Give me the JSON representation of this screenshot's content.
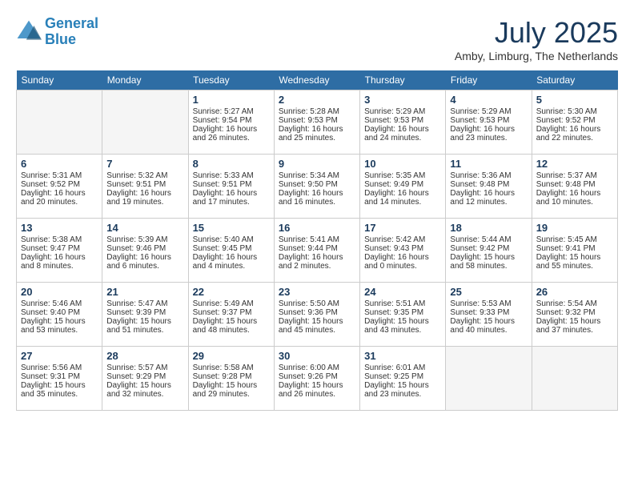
{
  "header": {
    "logo_line1": "General",
    "logo_line2": "Blue",
    "month": "July 2025",
    "location": "Amby, Limburg, The Netherlands"
  },
  "weekdays": [
    "Sunday",
    "Monday",
    "Tuesday",
    "Wednesday",
    "Thursday",
    "Friday",
    "Saturday"
  ],
  "weeks": [
    [
      {
        "day": "",
        "info": ""
      },
      {
        "day": "",
        "info": ""
      },
      {
        "day": "1",
        "info": "Sunrise: 5:27 AM\nSunset: 9:54 PM\nDaylight: 16 hours\nand 26 minutes."
      },
      {
        "day": "2",
        "info": "Sunrise: 5:28 AM\nSunset: 9:53 PM\nDaylight: 16 hours\nand 25 minutes."
      },
      {
        "day": "3",
        "info": "Sunrise: 5:29 AM\nSunset: 9:53 PM\nDaylight: 16 hours\nand 24 minutes."
      },
      {
        "day": "4",
        "info": "Sunrise: 5:29 AM\nSunset: 9:53 PM\nDaylight: 16 hours\nand 23 minutes."
      },
      {
        "day": "5",
        "info": "Sunrise: 5:30 AM\nSunset: 9:52 PM\nDaylight: 16 hours\nand 22 minutes."
      }
    ],
    [
      {
        "day": "6",
        "info": "Sunrise: 5:31 AM\nSunset: 9:52 PM\nDaylight: 16 hours\nand 20 minutes."
      },
      {
        "day": "7",
        "info": "Sunrise: 5:32 AM\nSunset: 9:51 PM\nDaylight: 16 hours\nand 19 minutes."
      },
      {
        "day": "8",
        "info": "Sunrise: 5:33 AM\nSunset: 9:51 PM\nDaylight: 16 hours\nand 17 minutes."
      },
      {
        "day": "9",
        "info": "Sunrise: 5:34 AM\nSunset: 9:50 PM\nDaylight: 16 hours\nand 16 minutes."
      },
      {
        "day": "10",
        "info": "Sunrise: 5:35 AM\nSunset: 9:49 PM\nDaylight: 16 hours\nand 14 minutes."
      },
      {
        "day": "11",
        "info": "Sunrise: 5:36 AM\nSunset: 9:48 PM\nDaylight: 16 hours\nand 12 minutes."
      },
      {
        "day": "12",
        "info": "Sunrise: 5:37 AM\nSunset: 9:48 PM\nDaylight: 16 hours\nand 10 minutes."
      }
    ],
    [
      {
        "day": "13",
        "info": "Sunrise: 5:38 AM\nSunset: 9:47 PM\nDaylight: 16 hours\nand 8 minutes."
      },
      {
        "day": "14",
        "info": "Sunrise: 5:39 AM\nSunset: 9:46 PM\nDaylight: 16 hours\nand 6 minutes."
      },
      {
        "day": "15",
        "info": "Sunrise: 5:40 AM\nSunset: 9:45 PM\nDaylight: 16 hours\nand 4 minutes."
      },
      {
        "day": "16",
        "info": "Sunrise: 5:41 AM\nSunset: 9:44 PM\nDaylight: 16 hours\nand 2 minutes."
      },
      {
        "day": "17",
        "info": "Sunrise: 5:42 AM\nSunset: 9:43 PM\nDaylight: 16 hours\nand 0 minutes."
      },
      {
        "day": "18",
        "info": "Sunrise: 5:44 AM\nSunset: 9:42 PM\nDaylight: 15 hours\nand 58 minutes."
      },
      {
        "day": "19",
        "info": "Sunrise: 5:45 AM\nSunset: 9:41 PM\nDaylight: 15 hours\nand 55 minutes."
      }
    ],
    [
      {
        "day": "20",
        "info": "Sunrise: 5:46 AM\nSunset: 9:40 PM\nDaylight: 15 hours\nand 53 minutes."
      },
      {
        "day": "21",
        "info": "Sunrise: 5:47 AM\nSunset: 9:39 PM\nDaylight: 15 hours\nand 51 minutes."
      },
      {
        "day": "22",
        "info": "Sunrise: 5:49 AM\nSunset: 9:37 PM\nDaylight: 15 hours\nand 48 minutes."
      },
      {
        "day": "23",
        "info": "Sunrise: 5:50 AM\nSunset: 9:36 PM\nDaylight: 15 hours\nand 45 minutes."
      },
      {
        "day": "24",
        "info": "Sunrise: 5:51 AM\nSunset: 9:35 PM\nDaylight: 15 hours\nand 43 minutes."
      },
      {
        "day": "25",
        "info": "Sunrise: 5:53 AM\nSunset: 9:33 PM\nDaylight: 15 hours\nand 40 minutes."
      },
      {
        "day": "26",
        "info": "Sunrise: 5:54 AM\nSunset: 9:32 PM\nDaylight: 15 hours\nand 37 minutes."
      }
    ],
    [
      {
        "day": "27",
        "info": "Sunrise: 5:56 AM\nSunset: 9:31 PM\nDaylight: 15 hours\nand 35 minutes."
      },
      {
        "day": "28",
        "info": "Sunrise: 5:57 AM\nSunset: 9:29 PM\nDaylight: 15 hours\nand 32 minutes."
      },
      {
        "day": "29",
        "info": "Sunrise: 5:58 AM\nSunset: 9:28 PM\nDaylight: 15 hours\nand 29 minutes."
      },
      {
        "day": "30",
        "info": "Sunrise: 6:00 AM\nSunset: 9:26 PM\nDaylight: 15 hours\nand 26 minutes."
      },
      {
        "day": "31",
        "info": "Sunrise: 6:01 AM\nSunset: 9:25 PM\nDaylight: 15 hours\nand 23 minutes."
      },
      {
        "day": "",
        "info": ""
      },
      {
        "day": "",
        "info": ""
      }
    ]
  ]
}
